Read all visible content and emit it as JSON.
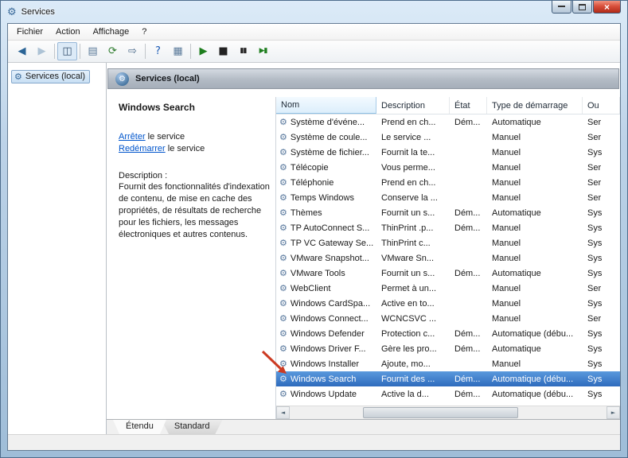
{
  "window": {
    "title": "Services",
    "close_glyph": "×"
  },
  "menubar": {
    "items": [
      "Fichier",
      "Action",
      "Affichage",
      "?"
    ]
  },
  "toolbar": {
    "buttons": [
      {
        "name": "back-button",
        "glyph": "◀",
        "color": "#2a6496"
      },
      {
        "name": "forward-button",
        "glyph": "▶",
        "color": "#2a6496",
        "disabled": true
      },
      {
        "sep": true
      },
      {
        "name": "show-console-tree-button",
        "glyph": "◫",
        "color": "#35506e",
        "pressed": true
      },
      {
        "sep": true
      },
      {
        "name": "properties-button",
        "glyph": "▤",
        "color": "#5a7a9a"
      },
      {
        "name": "refresh-button",
        "glyph": "⟳",
        "color": "#2a7a2a"
      },
      {
        "name": "export-list-button",
        "glyph": "⇨",
        "color": "#4a6a8a"
      },
      {
        "sep": true
      },
      {
        "name": "help-button",
        "glyph": "?",
        "color": "#1a5ab4"
      },
      {
        "name": "view-menu-button",
        "glyph": "▦",
        "color": "#5a7a9a"
      },
      {
        "sep": true
      },
      {
        "name": "start-service-button",
        "glyph": "▶",
        "color": "#1e7e1e"
      },
      {
        "name": "stop-service-button",
        "glyph": "■",
        "color": "#222222"
      },
      {
        "name": "pause-service-button",
        "glyph": "▮▮",
        "color": "#222222",
        "small": true
      },
      {
        "name": "restart-service-button",
        "glyph": "▶▮",
        "color": "#1e7e1e",
        "small": true
      }
    ]
  },
  "icons": {
    "gear": "⚙",
    "scroll_left": "◄",
    "scroll_right": "►"
  },
  "sidebar": {
    "root_label": "Services (local)"
  },
  "panel": {
    "header_title": "Services (local)"
  },
  "detail": {
    "service_name": "Windows Search",
    "links": [
      {
        "action": "Arrêter",
        "rest": " le service"
      },
      {
        "action": "Redémarrer",
        "rest": " le service"
      }
    ],
    "description_label": "Description :",
    "description_text": "Fournit des fonctionnalités d'indexation de contenu, de mise en cache des propriétés, de résultats de recherche pour les fichiers, les messages électroniques et autres contenus."
  },
  "table": {
    "columns": [
      "Nom",
      "Description",
      "État",
      "Type de démarrage",
      "Ou"
    ],
    "sorted_column": 0,
    "selected_row": "Windows Search",
    "rows": [
      {
        "name": "Système d'événe...",
        "description": "Prend en ch...",
        "state": "Dém...",
        "startup": "Automatique",
        "logon": "Ser"
      },
      {
        "name": "Système de coule...",
        "description": "Le service ...",
        "state": "",
        "startup": "Manuel",
        "logon": "Ser"
      },
      {
        "name": "Système de fichier...",
        "description": "Fournit la te...",
        "state": "",
        "startup": "Manuel",
        "logon": "Sys"
      },
      {
        "name": "Télécopie",
        "description": "Vous perme...",
        "state": "",
        "startup": "Manuel",
        "logon": "Ser"
      },
      {
        "name": "Téléphonie",
        "description": "Prend en ch...",
        "state": "",
        "startup": "Manuel",
        "logon": "Ser"
      },
      {
        "name": "Temps Windows",
        "description": "Conserve la ...",
        "state": "",
        "startup": "Manuel",
        "logon": "Ser"
      },
      {
        "name": "Thèmes",
        "description": "Fournit un s...",
        "state": "Dém...",
        "startup": "Automatique",
        "logon": "Sys"
      },
      {
        "name": "TP AutoConnect S...",
        "description": "ThinPrint .p...",
        "state": "Dém...",
        "startup": "Manuel",
        "logon": "Sys"
      },
      {
        "name": "TP VC Gateway Se...",
        "description": "ThinPrint c...",
        "state": "",
        "startup": "Manuel",
        "logon": "Sys"
      },
      {
        "name": "VMware Snapshot...",
        "description": "VMware Sn...",
        "state": "",
        "startup": "Manuel",
        "logon": "Sys"
      },
      {
        "name": "VMware Tools",
        "description": "Fournit un s...",
        "state": "Dém...",
        "startup": "Automatique",
        "logon": "Sys"
      },
      {
        "name": "WebClient",
        "description": "Permet à un...",
        "state": "",
        "startup": "Manuel",
        "logon": "Ser"
      },
      {
        "name": "Windows CardSpa...",
        "description": "Active en to...",
        "state": "",
        "startup": "Manuel",
        "logon": "Sys"
      },
      {
        "name": "Windows Connect...",
        "description": "WCNCSVC ...",
        "state": "",
        "startup": "Manuel",
        "logon": "Ser"
      },
      {
        "name": "Windows Defender",
        "description": "Protection c...",
        "state": "Dém...",
        "startup": "Automatique (débu...",
        "logon": "Sys"
      },
      {
        "name": "Windows Driver F...",
        "description": "Gère les pro...",
        "state": "Dém...",
        "startup": "Automatique",
        "logon": "Sys"
      },
      {
        "name": "Windows Installer",
        "description": "Ajoute, mo...",
        "state": "",
        "startup": "Manuel",
        "logon": "Sys"
      },
      {
        "name": "Windows Search",
        "description": "Fournit des ...",
        "state": "Dém...",
        "startup": "Automatique (débu...",
        "logon": "Sys"
      },
      {
        "name": "Windows Update",
        "description": "Active la d...",
        "state": "Dém...",
        "startup": "Automatique (débu...",
        "logon": "Sys"
      }
    ]
  },
  "tabs": {
    "items": [
      "Étendu",
      "Standard"
    ],
    "active": "Étendu"
  },
  "annotation": {
    "type": "red-arrow",
    "points_to": "Windows Search",
    "color": "#cc3b22"
  },
  "colors": {
    "selection": "#2e6bbd",
    "link": "#0055cc",
    "arrow": "#cc3b22"
  }
}
